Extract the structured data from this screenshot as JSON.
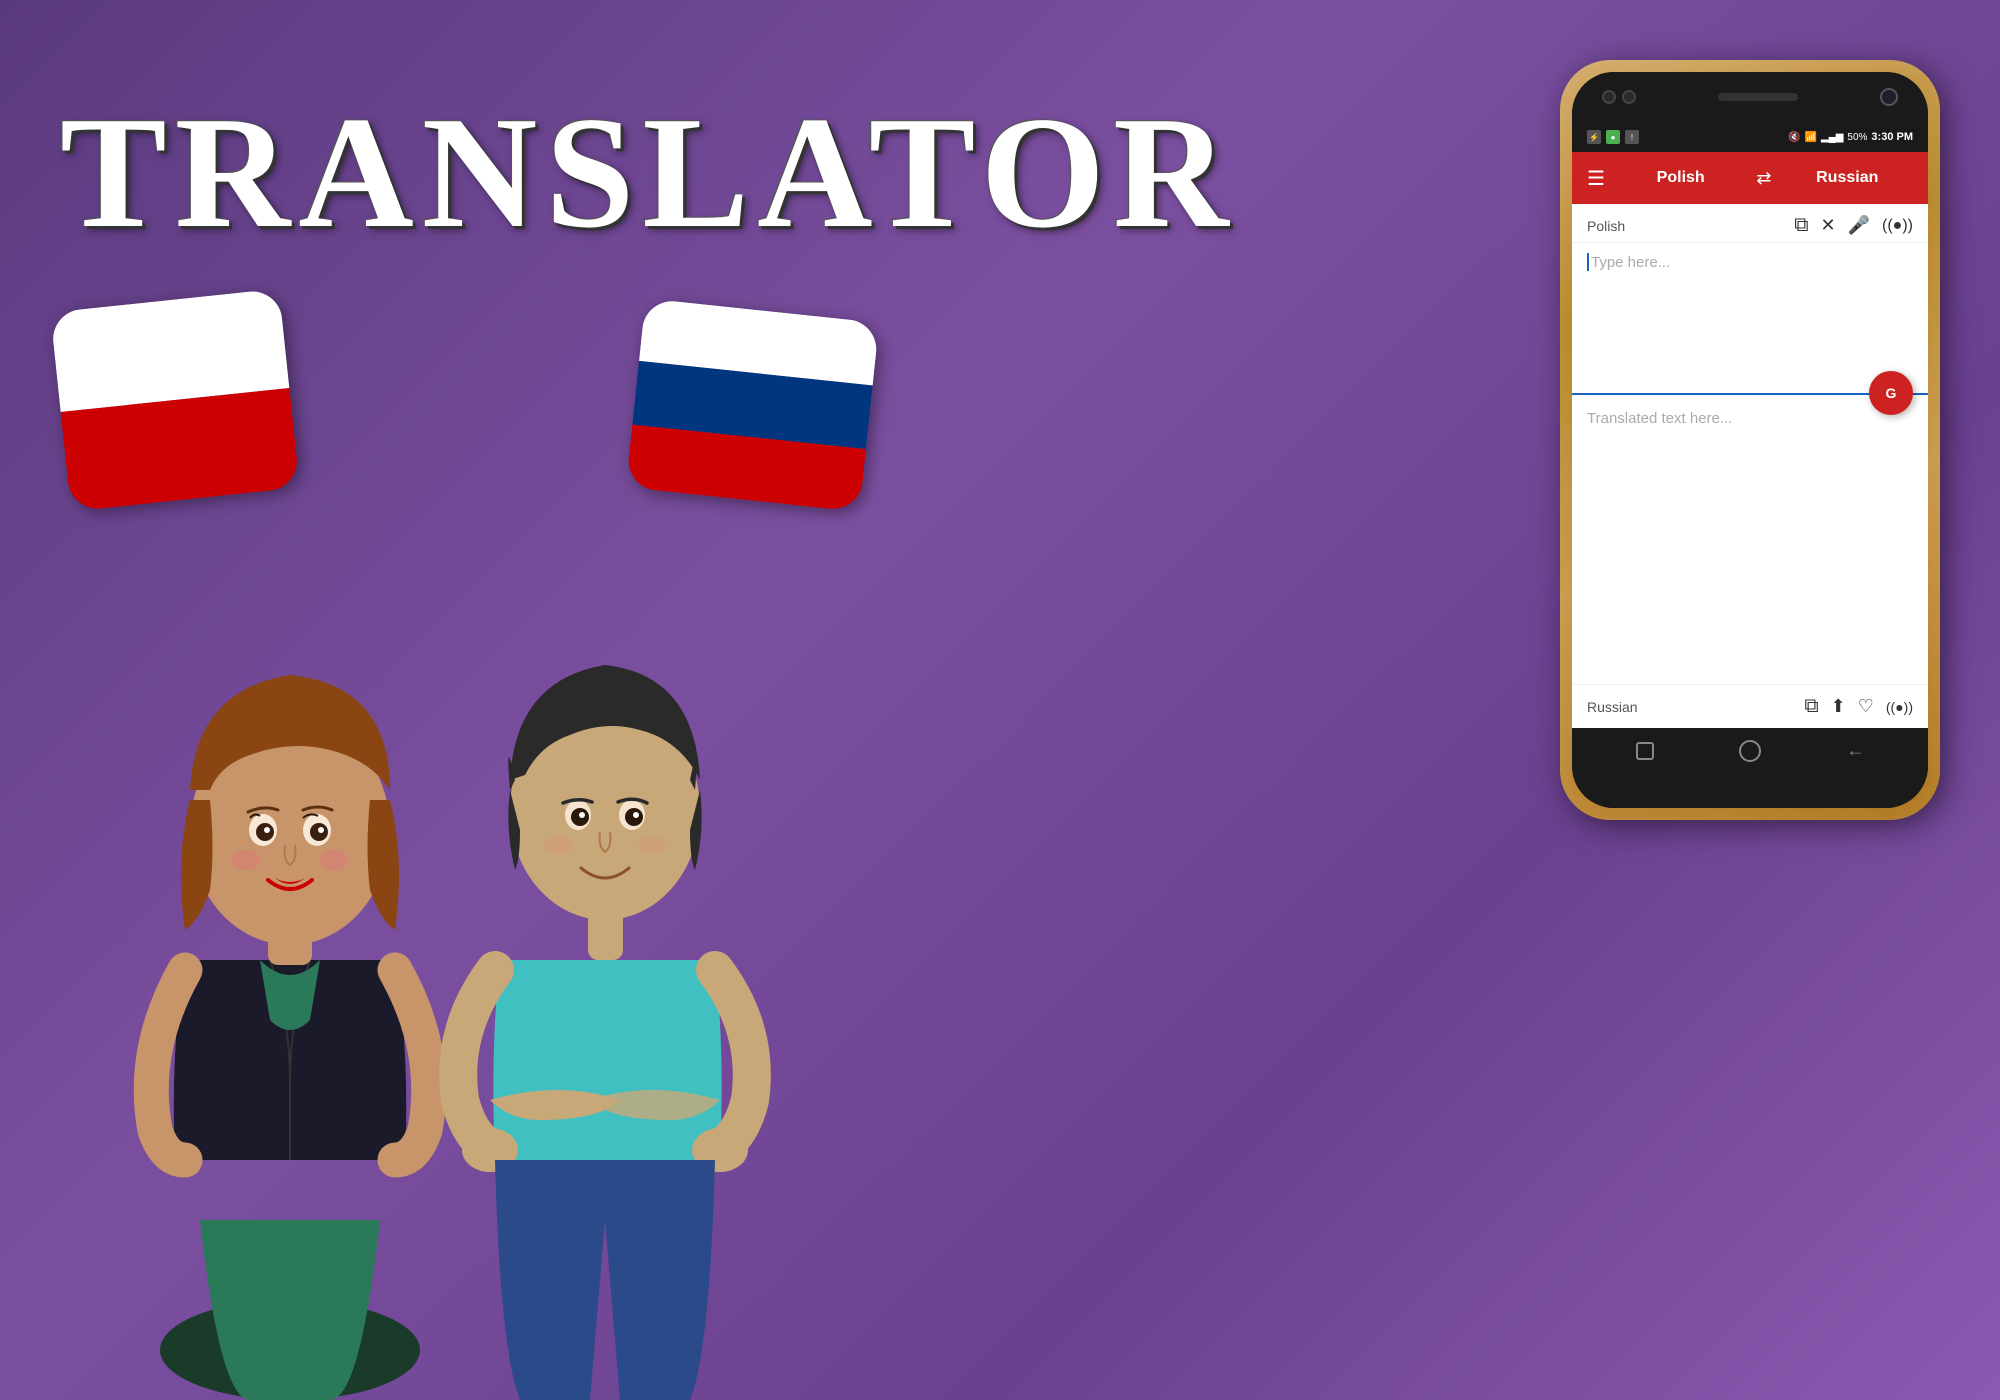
{
  "background": {
    "gradient_start": "#5a3a7e",
    "gradient_end": "#8a5ab0"
  },
  "title": {
    "text": "TRANSLATOR",
    "color": "#ffffff"
  },
  "speech_bubbles": {
    "left": {
      "flag": "Polish",
      "colors": [
        "#ffffff",
        "#cc0000"
      ]
    },
    "right": {
      "flag": "Russian",
      "colors": [
        "#ffffff",
        "#003580",
        "#cc0000"
      ]
    }
  },
  "phone": {
    "status_bar": {
      "time": "3:30 PM",
      "battery": "50%",
      "signal_bars": "▂▄▆",
      "wifi_icon": "wifi"
    },
    "toolbar": {
      "menu_icon": "☰",
      "source_lang": "Polish",
      "swap_icon": "⇄",
      "target_lang": "Russian"
    },
    "source_section": {
      "lang_label": "Polish",
      "icons": {
        "copy": "⧉",
        "clear": "✕",
        "mic": "🎤",
        "listen": "((•))"
      },
      "placeholder": "Type here..."
    },
    "translate_button": {
      "icon": "G↔"
    },
    "target_section": {
      "placeholder": "Translated text here...",
      "lang_label": "Russian",
      "icons": {
        "copy": "⧉",
        "share": "⬆",
        "favorite": "♡",
        "listen": "((•))"
      }
    },
    "nav_bar": {
      "back_icon": "←",
      "home_icon": "○",
      "recent_icon": "□"
    }
  }
}
